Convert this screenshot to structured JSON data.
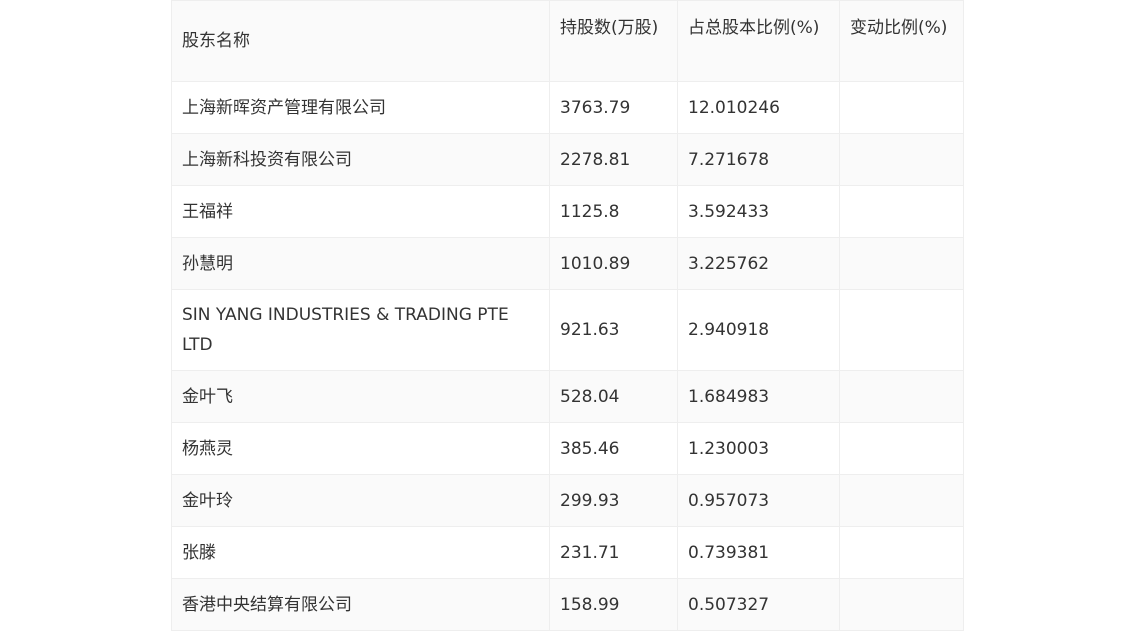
{
  "table": {
    "headers": [
      "股东名称",
      "持股数(万股)",
      "占总股本比例(%)",
      "变动比例(%)"
    ],
    "rows": [
      [
        "上海新晖资产管理有限公司",
        "3763.79",
        "12.010246",
        ""
      ],
      [
        "上海新科投资有限公司",
        "2278.81",
        "7.271678",
        ""
      ],
      [
        "王福祥",
        "1125.8",
        "3.592433",
        ""
      ],
      [
        "孙慧明",
        "1010.89",
        "3.225762",
        ""
      ],
      [
        "SIN YANG INDUSTRIES & TRADING PTE LTD",
        "921.63",
        "2.940918",
        ""
      ],
      [
        "金叶飞",
        "528.04",
        "1.684983",
        ""
      ],
      [
        "杨燕灵",
        "385.46",
        "1.230003",
        ""
      ],
      [
        "金叶玲",
        "299.93",
        "0.957073",
        ""
      ],
      [
        "张滕",
        "231.71",
        "0.739381",
        ""
      ],
      [
        "香港中央结算有限公司",
        "158.99",
        "0.507327",
        ""
      ]
    ]
  }
}
